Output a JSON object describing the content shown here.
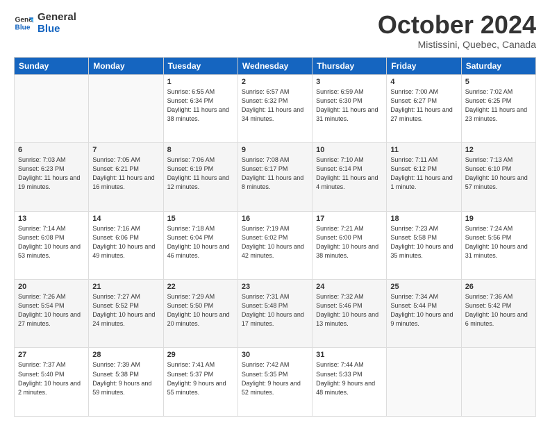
{
  "logo": {
    "line1": "General",
    "line2": "Blue"
  },
  "header": {
    "month": "October 2024",
    "location": "Mistissini, Quebec, Canada"
  },
  "weekdays": [
    "Sunday",
    "Monday",
    "Tuesday",
    "Wednesday",
    "Thursday",
    "Friday",
    "Saturday"
  ],
  "weeks": [
    [
      {
        "day": "",
        "info": ""
      },
      {
        "day": "",
        "info": ""
      },
      {
        "day": "1",
        "info": "Sunrise: 6:55 AM\nSunset: 6:34 PM\nDaylight: 11 hours and 38 minutes."
      },
      {
        "day": "2",
        "info": "Sunrise: 6:57 AM\nSunset: 6:32 PM\nDaylight: 11 hours and 34 minutes."
      },
      {
        "day": "3",
        "info": "Sunrise: 6:59 AM\nSunset: 6:30 PM\nDaylight: 11 hours and 31 minutes."
      },
      {
        "day": "4",
        "info": "Sunrise: 7:00 AM\nSunset: 6:27 PM\nDaylight: 11 hours and 27 minutes."
      },
      {
        "day": "5",
        "info": "Sunrise: 7:02 AM\nSunset: 6:25 PM\nDaylight: 11 hours and 23 minutes."
      }
    ],
    [
      {
        "day": "6",
        "info": "Sunrise: 7:03 AM\nSunset: 6:23 PM\nDaylight: 11 hours and 19 minutes."
      },
      {
        "day": "7",
        "info": "Sunrise: 7:05 AM\nSunset: 6:21 PM\nDaylight: 11 hours and 16 minutes."
      },
      {
        "day": "8",
        "info": "Sunrise: 7:06 AM\nSunset: 6:19 PM\nDaylight: 11 hours and 12 minutes."
      },
      {
        "day": "9",
        "info": "Sunrise: 7:08 AM\nSunset: 6:17 PM\nDaylight: 11 hours and 8 minutes."
      },
      {
        "day": "10",
        "info": "Sunrise: 7:10 AM\nSunset: 6:14 PM\nDaylight: 11 hours and 4 minutes."
      },
      {
        "day": "11",
        "info": "Sunrise: 7:11 AM\nSunset: 6:12 PM\nDaylight: 11 hours and 1 minute."
      },
      {
        "day": "12",
        "info": "Sunrise: 7:13 AM\nSunset: 6:10 PM\nDaylight: 10 hours and 57 minutes."
      }
    ],
    [
      {
        "day": "13",
        "info": "Sunrise: 7:14 AM\nSunset: 6:08 PM\nDaylight: 10 hours and 53 minutes."
      },
      {
        "day": "14",
        "info": "Sunrise: 7:16 AM\nSunset: 6:06 PM\nDaylight: 10 hours and 49 minutes."
      },
      {
        "day": "15",
        "info": "Sunrise: 7:18 AM\nSunset: 6:04 PM\nDaylight: 10 hours and 46 minutes."
      },
      {
        "day": "16",
        "info": "Sunrise: 7:19 AM\nSunset: 6:02 PM\nDaylight: 10 hours and 42 minutes."
      },
      {
        "day": "17",
        "info": "Sunrise: 7:21 AM\nSunset: 6:00 PM\nDaylight: 10 hours and 38 minutes."
      },
      {
        "day": "18",
        "info": "Sunrise: 7:23 AM\nSunset: 5:58 PM\nDaylight: 10 hours and 35 minutes."
      },
      {
        "day": "19",
        "info": "Sunrise: 7:24 AM\nSunset: 5:56 PM\nDaylight: 10 hours and 31 minutes."
      }
    ],
    [
      {
        "day": "20",
        "info": "Sunrise: 7:26 AM\nSunset: 5:54 PM\nDaylight: 10 hours and 27 minutes."
      },
      {
        "day": "21",
        "info": "Sunrise: 7:27 AM\nSunset: 5:52 PM\nDaylight: 10 hours and 24 minutes."
      },
      {
        "day": "22",
        "info": "Sunrise: 7:29 AM\nSunset: 5:50 PM\nDaylight: 10 hours and 20 minutes."
      },
      {
        "day": "23",
        "info": "Sunrise: 7:31 AM\nSunset: 5:48 PM\nDaylight: 10 hours and 17 minutes."
      },
      {
        "day": "24",
        "info": "Sunrise: 7:32 AM\nSunset: 5:46 PM\nDaylight: 10 hours and 13 minutes."
      },
      {
        "day": "25",
        "info": "Sunrise: 7:34 AM\nSunset: 5:44 PM\nDaylight: 10 hours and 9 minutes."
      },
      {
        "day": "26",
        "info": "Sunrise: 7:36 AM\nSunset: 5:42 PM\nDaylight: 10 hours and 6 minutes."
      }
    ],
    [
      {
        "day": "27",
        "info": "Sunrise: 7:37 AM\nSunset: 5:40 PM\nDaylight: 10 hours and 2 minutes."
      },
      {
        "day": "28",
        "info": "Sunrise: 7:39 AM\nSunset: 5:38 PM\nDaylight: 9 hours and 59 minutes."
      },
      {
        "day": "29",
        "info": "Sunrise: 7:41 AM\nSunset: 5:37 PM\nDaylight: 9 hours and 55 minutes."
      },
      {
        "day": "30",
        "info": "Sunrise: 7:42 AM\nSunset: 5:35 PM\nDaylight: 9 hours and 52 minutes."
      },
      {
        "day": "31",
        "info": "Sunrise: 7:44 AM\nSunset: 5:33 PM\nDaylight: 9 hours and 48 minutes."
      },
      {
        "day": "",
        "info": ""
      },
      {
        "day": "",
        "info": ""
      }
    ]
  ]
}
